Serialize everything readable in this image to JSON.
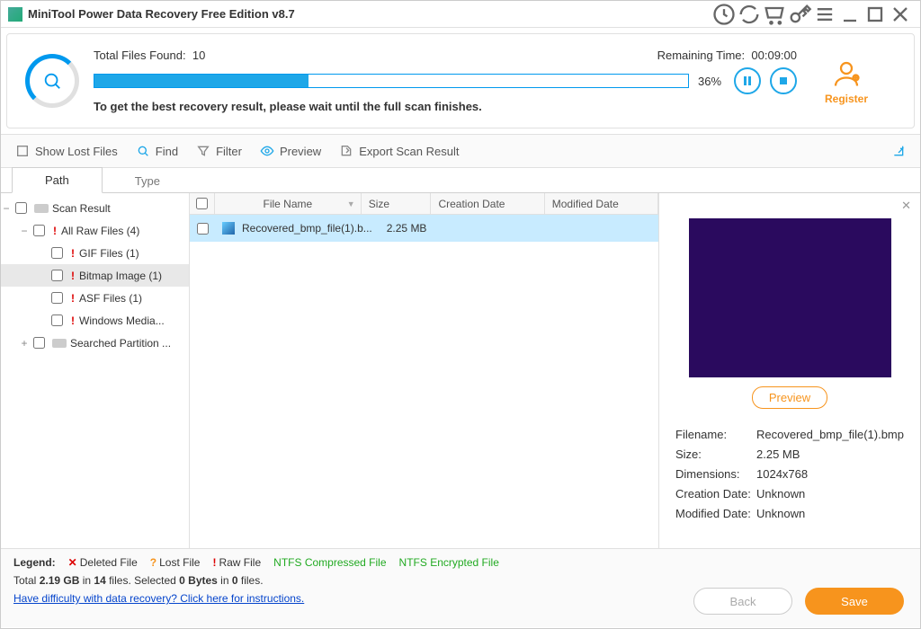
{
  "title": "MiniTool Power Data Recovery Free Edition v8.7",
  "scan": {
    "total_label": "Total Files Found:",
    "total_value": "10",
    "remaining_label": "Remaining Time:",
    "remaining_value": "00:09:00",
    "percent": "36%",
    "percent_num": 36,
    "message": "To get the best recovery result, please wait until the full scan finishes."
  },
  "register_label": "Register",
  "toolbar": {
    "show_lost": "Show Lost Files",
    "find": "Find",
    "filter": "Filter",
    "preview": "Preview",
    "export": "Export Scan Result"
  },
  "tabs": {
    "path": "Path",
    "type": "Type"
  },
  "tree": {
    "root": "Scan Result",
    "raw": "All Raw Files (4)",
    "gif": "GIF Files (1)",
    "bitmap": "Bitmap Image (1)",
    "asf": "ASF Files (1)",
    "wmv": "Windows Media...",
    "searched": "Searched Partition ..."
  },
  "cols": {
    "name": "File Name",
    "size": "Size",
    "cdate": "Creation Date",
    "mdate": "Modified Date"
  },
  "row": {
    "name": "Recovered_bmp_file(1).b...",
    "size": "2.25 MB"
  },
  "preview": {
    "button": "Preview",
    "filename_lab": "Filename:",
    "filename_val": "Recovered_bmp_file(1).bmp",
    "size_lab": "Size:",
    "size_val": "2.25 MB",
    "dim_lab": "Dimensions:",
    "dim_val": "1024x768",
    "cdate_lab": "Creation Date:",
    "cdate_val": "Unknown",
    "mdate_lab": "Modified Date:",
    "mdate_val": "Unknown"
  },
  "legend": {
    "title": "Legend:",
    "deleted": "Deleted File",
    "lost": "Lost File",
    "raw": "Raw File",
    "compressed": "NTFS Compressed File",
    "encrypted": "NTFS Encrypted File"
  },
  "totals": {
    "t1": "Total ",
    "size": "2.19 GB",
    "t2": " in ",
    "files": "14",
    "t3": " files.   Selected ",
    "sel_bytes": "0 Bytes",
    "t4": " in ",
    "sel_files": "0",
    "t5": " files."
  },
  "help_link": "Have difficulty with data recovery? Click here for instructions.",
  "buttons": {
    "back": "Back",
    "save": "Save"
  }
}
